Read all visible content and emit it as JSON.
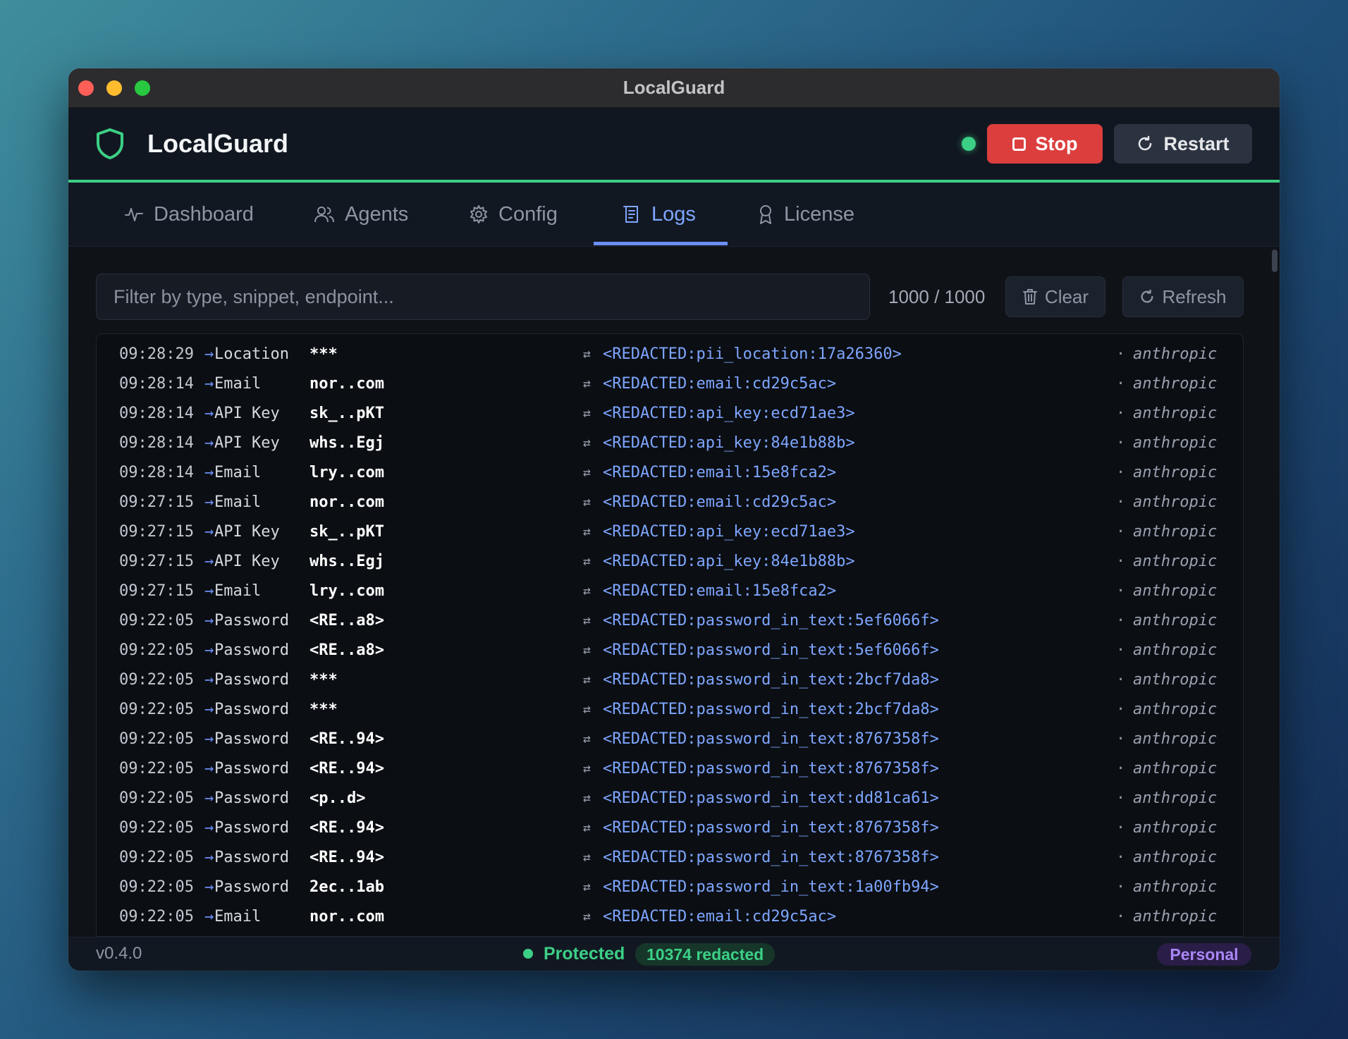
{
  "window": {
    "title": "LocalGuard"
  },
  "header": {
    "app_name": "LocalGuard",
    "status_color": "#3ccf86",
    "stop_label": "Stop",
    "restart_label": "Restart"
  },
  "tabs": [
    {
      "label": "Dashboard",
      "icon": "activity-icon"
    },
    {
      "label": "Agents",
      "icon": "users-icon"
    },
    {
      "label": "Config",
      "icon": "gear-icon"
    },
    {
      "label": "Logs",
      "icon": "logs-icon",
      "active": true
    },
    {
      "label": "License",
      "icon": "award-icon"
    }
  ],
  "toolbar": {
    "filter_placeholder": "Filter by type, snippet, endpoint...",
    "count": "1000 / 1000",
    "clear_label": "Clear",
    "refresh_label": "Refresh"
  },
  "logs": [
    {
      "time": "09:28:29",
      "type": "Location",
      "snippet": "***",
      "redacted": "<REDACTED:pii_location:17a26360>",
      "endpoint": "anthropic"
    },
    {
      "time": "09:28:14",
      "type": "Email",
      "snippet": "nor..com",
      "redacted": "<REDACTED:email:cd29c5ac>",
      "endpoint": "anthropic"
    },
    {
      "time": "09:28:14",
      "type": "API Key",
      "snippet": "sk_..pKT",
      "redacted": "<REDACTED:api_key:ecd71ae3>",
      "endpoint": "anthropic"
    },
    {
      "time": "09:28:14",
      "type": "API Key",
      "snippet": "whs..Egj",
      "redacted": "<REDACTED:api_key:84e1b88b>",
      "endpoint": "anthropic"
    },
    {
      "time": "09:28:14",
      "type": "Email",
      "snippet": "lry..com",
      "redacted": "<REDACTED:email:15e8fca2>",
      "endpoint": "anthropic"
    },
    {
      "time": "09:27:15",
      "type": "Email",
      "snippet": "nor..com",
      "redacted": "<REDACTED:email:cd29c5ac>",
      "endpoint": "anthropic"
    },
    {
      "time": "09:27:15",
      "type": "API Key",
      "snippet": "sk_..pKT",
      "redacted": "<REDACTED:api_key:ecd71ae3>",
      "endpoint": "anthropic"
    },
    {
      "time": "09:27:15",
      "type": "API Key",
      "snippet": "whs..Egj",
      "redacted": "<REDACTED:api_key:84e1b88b>",
      "endpoint": "anthropic"
    },
    {
      "time": "09:27:15",
      "type": "Email",
      "snippet": "lry..com",
      "redacted": "<REDACTED:email:15e8fca2>",
      "endpoint": "anthropic"
    },
    {
      "time": "09:22:05",
      "type": "Password",
      "snippet": "<RE..a8>",
      "redacted": "<REDACTED:password_in_text:5ef6066f>",
      "endpoint": "anthropic"
    },
    {
      "time": "09:22:05",
      "type": "Password",
      "snippet": "<RE..a8>",
      "redacted": "<REDACTED:password_in_text:5ef6066f>",
      "endpoint": "anthropic"
    },
    {
      "time": "09:22:05",
      "type": "Password",
      "snippet": "***",
      "redacted": "<REDACTED:password_in_text:2bcf7da8>",
      "endpoint": "anthropic"
    },
    {
      "time": "09:22:05",
      "type": "Password",
      "snippet": "***",
      "redacted": "<REDACTED:password_in_text:2bcf7da8>",
      "endpoint": "anthropic"
    },
    {
      "time": "09:22:05",
      "type": "Password",
      "snippet": "<RE..94>",
      "redacted": "<REDACTED:password_in_text:8767358f>",
      "endpoint": "anthropic"
    },
    {
      "time": "09:22:05",
      "type": "Password",
      "snippet": "<RE..94>",
      "redacted": "<REDACTED:password_in_text:8767358f>",
      "endpoint": "anthropic"
    },
    {
      "time": "09:22:05",
      "type": "Password",
      "snippet": "<p..d>",
      "redacted": "<REDACTED:password_in_text:dd81ca61>",
      "endpoint": "anthropic"
    },
    {
      "time": "09:22:05",
      "type": "Password",
      "snippet": "<RE..94>",
      "redacted": "<REDACTED:password_in_text:8767358f>",
      "endpoint": "anthropic"
    },
    {
      "time": "09:22:05",
      "type": "Password",
      "snippet": "<RE..94>",
      "redacted": "<REDACTED:password_in_text:8767358f>",
      "endpoint": "anthropic"
    },
    {
      "time": "09:22:05",
      "type": "Password",
      "snippet": "2ec..1ab",
      "redacted": "<REDACTED:password_in_text:1a00fb94>",
      "endpoint": "anthropic"
    },
    {
      "time": "09:22:05",
      "type": "Email",
      "snippet": "nor..com",
      "redacted": "<REDACTED:email:cd29c5ac>",
      "endpoint": "anthropic"
    }
  ],
  "footer": {
    "version": "v0.4.0",
    "status": "Protected",
    "redacted_count": "10374 redacted",
    "plan": "Personal"
  },
  "colors": {
    "accent": "#7ea6ff",
    "success": "#3ccf86",
    "danger": "#dc3e3e",
    "plan": "#a987f5"
  }
}
